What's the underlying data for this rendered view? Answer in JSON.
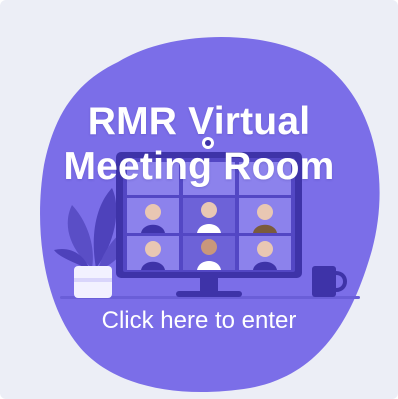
{
  "card": {
    "title_line1": "RMR Virtual",
    "title_line2": "Meeting Room",
    "cta_label": "Click here to enter"
  },
  "colors": {
    "background": "#eceef6",
    "blob": "#7b6ee8",
    "monitor": "#3e33a8",
    "text": "#ffffff"
  }
}
